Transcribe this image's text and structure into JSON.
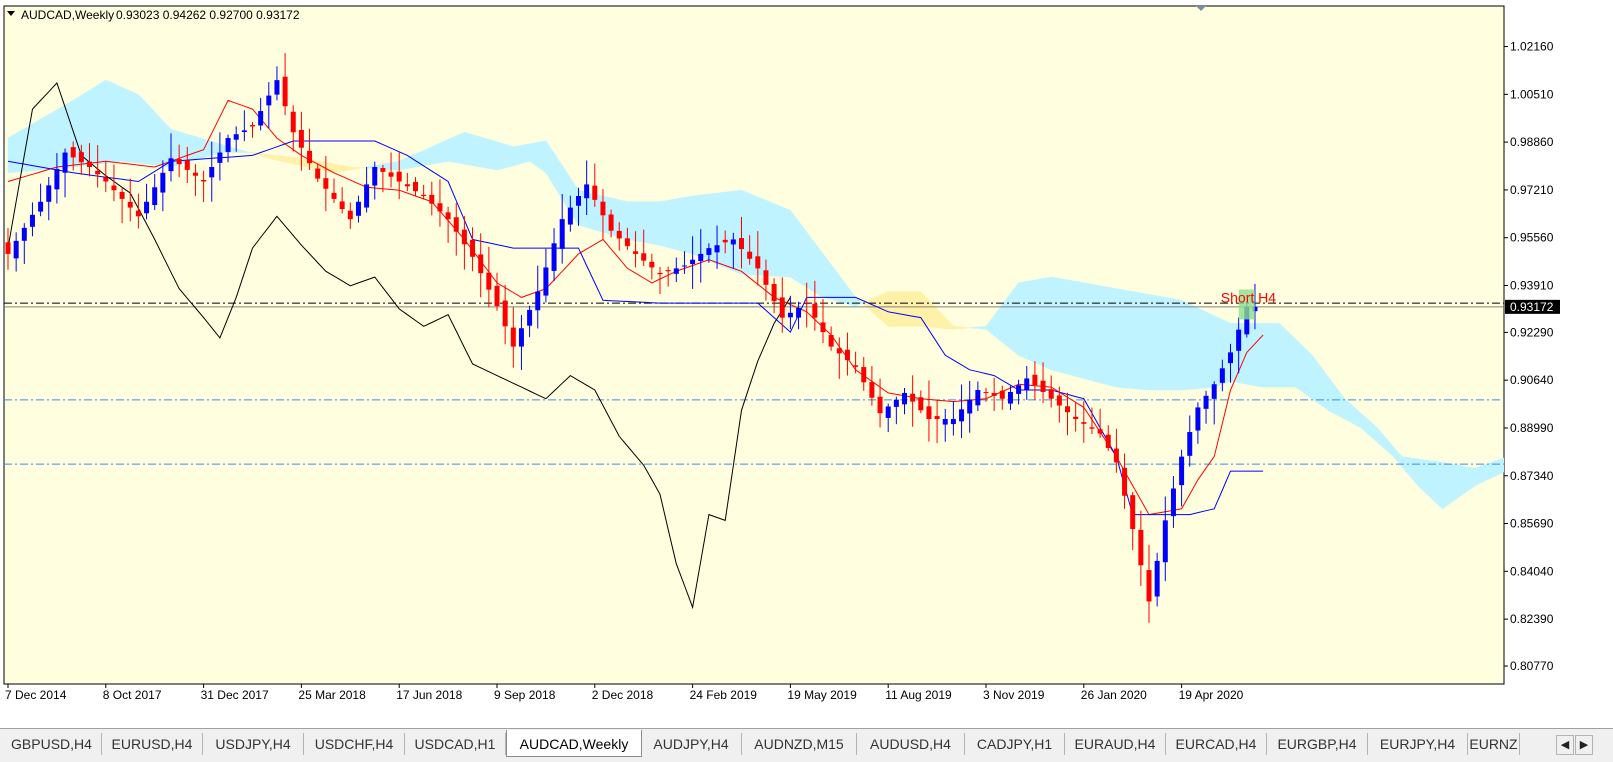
{
  "chart_header": {
    "symbol_label": "AUDCAD,Weekly",
    "ohlc_text": "0.93023 0.94262 0.92700 0.93172"
  },
  "colors": {
    "background": "#ffffe0",
    "frame": "#000000",
    "bull": "#0000ff",
    "bear": "#ff0000",
    "tenkan": "#ff0000",
    "kijun": "#0000ff",
    "chikou": "#000000",
    "cloud_bull": "#fff1a8",
    "cloud_bear": "#bff3ff",
    "hline": "#3c8ce6"
  },
  "chart_data": {
    "type": "candlestick",
    "symbol": "AUDCAD",
    "timeframe": "Weekly",
    "last_price": 0.93172,
    "price_tag": "0.93172",
    "ylim": [
      0.8015,
      1.0356
    ],
    "y_ticks": [
      "1.02160",
      "1.00510",
      "0.98860",
      "0.97210",
      "0.95560",
      "0.93910",
      "0.92290",
      "0.90640",
      "0.88990",
      "0.87340",
      "0.85690",
      "0.84040",
      "0.82390",
      "0.80770"
    ],
    "x_ticks": [
      "7 Dec 2014",
      "8 Oct 2017",
      "31 Dec 2017",
      "25 Mar 2018",
      "17 Jun 2018",
      "9 Sep 2018",
      "2 Dec 2018",
      "24 Feb 2019",
      "19 May 2019",
      "11 Aug 2019",
      "3 Nov 2019",
      "26 Jan 2020",
      "19 Apr 2020"
    ],
    "x_tick_bar_index": [
      0,
      12,
      24,
      36,
      48,
      60,
      72,
      84,
      96,
      108,
      120,
      132,
      144
    ],
    "n_bars": 154,
    "indicator": "Ichimoku Kinko Hyo",
    "annotation": {
      "text": "Short H4",
      "bar_index": 152,
      "price": 0.9329
    },
    "horizontal_lines": [
      {
        "price": 0.933,
        "style": "dashdot",
        "color": "#000000"
      },
      {
        "price": 0.9317,
        "style": "solid",
        "color": "#808080"
      },
      {
        "price": 0.8996,
        "style": "dashdot",
        "color": "#3c8ce6"
      },
      {
        "price": 0.8774,
        "style": "dashdot",
        "color": "#3c8ce6"
      }
    ],
    "close_anchors": [
      [
        0,
        0.95
      ],
      [
        4,
        0.968
      ],
      [
        7,
        0.985
      ],
      [
        10,
        0.98
      ],
      [
        12,
        0.975
      ],
      [
        16,
        0.963
      ],
      [
        20,
        0.983
      ],
      [
        24,
        0.975
      ],
      [
        27,
        0.99
      ],
      [
        30,
        0.994
      ],
      [
        33,
        1.01
      ],
      [
        35,
        0.992
      ],
      [
        38,
        0.976
      ],
      [
        42,
        0.962
      ],
      [
        45,
        0.98
      ],
      [
        48,
        0.975
      ],
      [
        51,
        0.97
      ],
      [
        54,
        0.962
      ],
      [
        57,
        0.949
      ],
      [
        60,
        0.932
      ],
      [
        62,
        0.918
      ],
      [
        65,
        0.937
      ],
      [
        68,
        0.962
      ],
      [
        71,
        0.974
      ],
      [
        74,
        0.958
      ],
      [
        77,
        0.95
      ],
      [
        80,
        0.943
      ],
      [
        83,
        0.946
      ],
      [
        86,
        0.952
      ],
      [
        89,
        0.955
      ],
      [
        92,
        0.945
      ],
      [
        95,
        0.928
      ],
      [
        98,
        0.933
      ],
      [
        101,
        0.918
      ],
      [
        104,
        0.911
      ],
      [
        107,
        0.895
      ],
      [
        110,
        0.902
      ],
      [
        113,
        0.893
      ],
      [
        116,
        0.893
      ],
      [
        119,
        0.903
      ],
      [
        122,
        0.9
      ],
      [
        125,
        0.907
      ],
      [
        128,
        0.9
      ],
      [
        131,
        0.893
      ],
      [
        134,
        0.888
      ],
      [
        136,
        0.878
      ],
      [
        138,
        0.855
      ],
      [
        140,
        0.83
      ],
      [
        142,
        0.858
      ],
      [
        144,
        0.88
      ],
      [
        146,
        0.897
      ],
      [
        148,
        0.905
      ],
      [
        150,
        0.916
      ],
      [
        152,
        0.9317
      ],
      [
        153,
        0.9317
      ]
    ],
    "chikou_anchors": [
      [
        0,
        0.952
      ],
      [
        3,
        1.0
      ],
      [
        6,
        1.009
      ],
      [
        9,
        0.984
      ],
      [
        12,
        0.977
      ],
      [
        15,
        0.971
      ],
      [
        18,
        0.955
      ],
      [
        21,
        0.938
      ],
      [
        24,
        0.928
      ],
      [
        26,
        0.921
      ],
      [
        28,
        0.935
      ],
      [
        30,
        0.952
      ],
      [
        33,
        0.963
      ],
      [
        36,
        0.953
      ],
      [
        39,
        0.944
      ],
      [
        42,
        0.939
      ],
      [
        45,
        0.942
      ],
      [
        48,
        0.931
      ],
      [
        51,
        0.925
      ],
      [
        54,
        0.929
      ],
      [
        57,
        0.912
      ],
      [
        60,
        0.908
      ],
      [
        63,
        0.904
      ],
      [
        66,
        0.9
      ],
      [
        69,
        0.908
      ],
      [
        72,
        0.903
      ],
      [
        75,
        0.887
      ],
      [
        78,
        0.877
      ],
      [
        80,
        0.867
      ],
      [
        82,
        0.843
      ],
      [
        84,
        0.828
      ],
      [
        86,
        0.86
      ],
      [
        88,
        0.858
      ],
      [
        90,
        0.896
      ],
      [
        92,
        0.913
      ],
      [
        94,
        0.926
      ],
      [
        96,
        0.935
      ]
    ],
    "tenkan_anchors": [
      [
        0,
        0.975
      ],
      [
        6,
        0.98
      ],
      [
        12,
        0.982
      ],
      [
        18,
        0.98
      ],
      [
        24,
        0.986
      ],
      [
        27,
        1.003
      ],
      [
        30,
        1.0
      ],
      [
        33,
        0.99
      ],
      [
        36,
        0.984
      ],
      [
        40,
        0.978
      ],
      [
        44,
        0.973
      ],
      [
        48,
        0.972
      ],
      [
        52,
        0.968
      ],
      [
        56,
        0.955
      ],
      [
        60,
        0.94
      ],
      [
        63,
        0.935
      ],
      [
        66,
        0.938
      ],
      [
        70,
        0.95
      ],
      [
        73,
        0.955
      ],
      [
        76,
        0.945
      ],
      [
        79,
        0.94
      ],
      [
        82,
        0.944
      ],
      [
        86,
        0.948
      ],
      [
        90,
        0.944
      ],
      [
        94,
        0.935
      ],
      [
        98,
        0.93
      ],
      [
        101,
        0.922
      ],
      [
        104,
        0.91
      ],
      [
        108,
        0.902
      ],
      [
        112,
        0.9
      ],
      [
        116,
        0.899
      ],
      [
        120,
        0.9
      ],
      [
        124,
        0.905
      ],
      [
        128,
        0.904
      ],
      [
        132,
        0.897
      ],
      [
        136,
        0.88
      ],
      [
        140,
        0.86
      ],
      [
        144,
        0.862
      ],
      [
        146,
        0.872
      ],
      [
        148,
        0.88
      ],
      [
        150,
        0.903
      ],
      [
        152,
        0.916
      ],
      [
        154,
        0.922
      ]
    ],
    "kijun_anchors": [
      [
        0,
        0.982
      ],
      [
        8,
        0.978
      ],
      [
        16,
        0.975
      ],
      [
        20,
        0.982
      ],
      [
        30,
        0.984
      ],
      [
        35,
        0.989
      ],
      [
        45,
        0.989
      ],
      [
        49,
        0.984
      ],
      [
        54,
        0.975
      ],
      [
        57,
        0.955
      ],
      [
        62,
        0.952
      ],
      [
        70,
        0.952
      ],
      [
        73,
        0.934
      ],
      [
        80,
        0.933
      ],
      [
        88,
        0.933
      ],
      [
        92,
        0.933
      ],
      [
        96,
        0.923
      ],
      [
        98,
        0.935
      ],
      [
        104,
        0.935
      ],
      [
        108,
        0.93
      ],
      [
        112,
        0.928
      ],
      [
        115,
        0.915
      ],
      [
        118,
        0.91
      ],
      [
        121,
        0.908
      ],
      [
        124,
        0.903
      ],
      [
        128,
        0.903
      ],
      [
        132,
        0.9
      ],
      [
        136,
        0.88
      ],
      [
        138,
        0.86
      ],
      [
        140,
        0.86
      ],
      [
        145,
        0.86
      ],
      [
        148,
        0.862
      ],
      [
        150,
        0.875
      ],
      [
        154,
        0.875
      ]
    ],
    "span_a_anchors": [
      [
        0,
        0.978
      ],
      [
        8,
        0.98
      ],
      [
        14,
        0.982
      ],
      [
        20,
        0.98
      ],
      [
        26,
        0.985
      ],
      [
        30,
        0.985
      ],
      [
        36,
        0.983
      ],
      [
        42,
        0.98
      ],
      [
        48,
        0.979
      ],
      [
        54,
        0.982
      ],
      [
        60,
        0.979
      ],
      [
        64,
        0.982
      ],
      [
        66,
        0.978
      ],
      [
        70,
        0.96
      ],
      [
        76,
        0.955
      ],
      [
        80,
        0.953
      ],
      [
        84,
        0.95
      ],
      [
        90,
        0.943
      ],
      [
        96,
        0.942
      ],
      [
        100,
        0.935
      ],
      [
        104,
        0.932
      ],
      [
        108,
        0.937
      ],
      [
        112,
        0.937
      ],
      [
        116,
        0.925
      ],
      [
        120,
        0.924
      ],
      [
        124,
        0.915
      ],
      [
        128,
        0.91
      ],
      [
        132,
        0.907
      ],
      [
        136,
        0.904
      ],
      [
        140,
        0.903
      ],
      [
        144,
        0.903
      ],
      [
        148,
        0.904
      ],
      [
        150,
        0.906
      ],
      [
        154,
        0.904
      ],
      [
        158,
        0.904
      ],
      [
        162,
        0.896
      ],
      [
        166,
        0.89
      ],
      [
        170,
        0.88
      ],
      [
        173,
        0.87
      ],
      [
        176,
        0.862
      ],
      [
        180,
        0.87
      ],
      [
        186,
        0.878
      ],
      [
        192,
        0.878
      ]
    ],
    "span_b_anchors": [
      [
        0,
        0.99
      ],
      [
        8,
        1.003
      ],
      [
        12,
        1.01
      ],
      [
        16,
        1.005
      ],
      [
        20,
        0.993
      ],
      [
        26,
        0.988
      ],
      [
        32,
        0.983
      ],
      [
        40,
        0.978
      ],
      [
        48,
        0.982
      ],
      [
        56,
        0.992
      ],
      [
        62,
        0.987
      ],
      [
        66,
        0.989
      ],
      [
        70,
        0.972
      ],
      [
        76,
        0.968
      ],
      [
        80,
        0.968
      ],
      [
        84,
        0.97
      ],
      [
        90,
        0.972
      ],
      [
        96,
        0.965
      ],
      [
        100,
        0.95
      ],
      [
        104,
        0.935
      ],
      [
        108,
        0.925
      ],
      [
        112,
        0.925
      ],
      [
        116,
        0.924
      ],
      [
        120,
        0.925
      ],
      [
        124,
        0.94
      ],
      [
        128,
        0.942
      ],
      [
        132,
        0.94
      ],
      [
        136,
        0.938
      ],
      [
        140,
        0.936
      ],
      [
        144,
        0.934
      ],
      [
        150,
        0.926
      ],
      [
        156,
        0.926
      ],
      [
        160,
        0.915
      ],
      [
        164,
        0.9
      ],
      [
        168,
        0.89
      ],
      [
        171,
        0.88
      ],
      [
        176,
        0.878
      ],
      [
        180,
        0.876
      ],
      [
        184,
        0.88
      ],
      [
        188,
        0.89
      ],
      [
        192,
        0.916
      ]
    ]
  },
  "tabs": [
    {
      "label": "GBPUSD,H4",
      "active": false
    },
    {
      "label": "EURUSD,H4",
      "active": false
    },
    {
      "label": "USDJPY,H4",
      "active": false
    },
    {
      "label": "USDCHF,H4",
      "active": false
    },
    {
      "label": "USDCAD,H1",
      "active": false
    },
    {
      "label": "AUDCAD,Weekly",
      "active": true
    },
    {
      "label": "AUDJPY,H4",
      "active": false
    },
    {
      "label": "AUDNZD,M15",
      "active": false
    },
    {
      "label": "AUDUSD,H4",
      "active": false
    },
    {
      "label": "CADJPY,H1",
      "active": false
    },
    {
      "label": "EURAUD,H4",
      "active": false
    },
    {
      "label": "EURCAD,H4",
      "active": false
    },
    {
      "label": "EURGBP,H4",
      "active": false
    },
    {
      "label": "EURJPY,H4",
      "active": false
    },
    {
      "label": "EURNZ",
      "active": false
    }
  ],
  "tab_nav": {
    "left_icon": "arrow-left-icon",
    "right_icon": "arrow-right-icon"
  }
}
